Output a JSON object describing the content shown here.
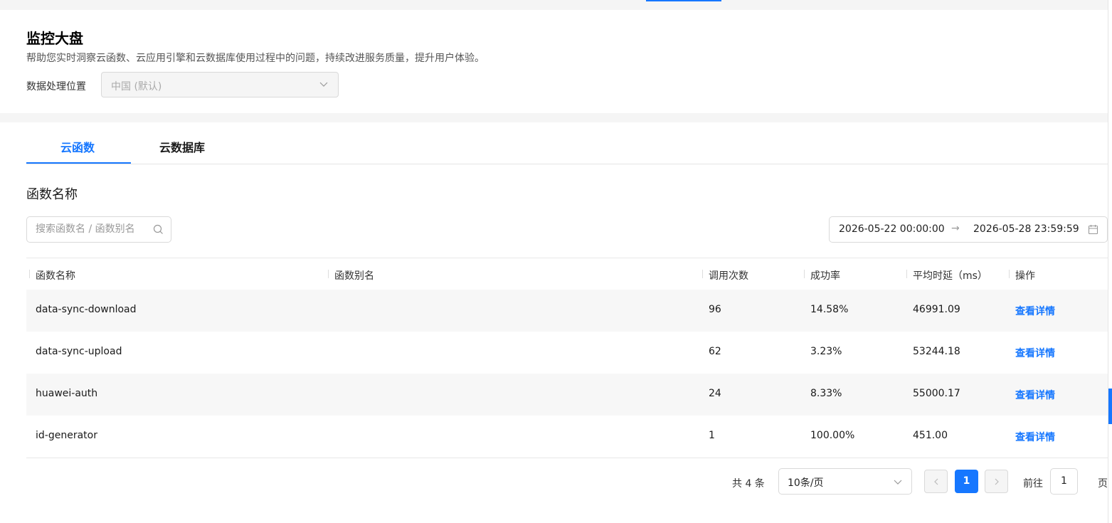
{
  "header": {
    "title": "监控大盘",
    "description": "帮助您实时洞察云函数、云应用引擎和云数据库使用过程中的问题，持续改进服务质量，提升用户体验。",
    "location_label": "数据处理位置",
    "location_value": "中国 (默认)"
  },
  "tabs": [
    {
      "label": "云函数",
      "active": true
    },
    {
      "label": "云数据库",
      "active": false
    }
  ],
  "section": {
    "title": "函数名称",
    "search_placeholder": "搜索函数名 / 函数别名"
  },
  "date_range": {
    "start": "2026-05-22 00:00:00",
    "separator": "→",
    "end": "2026-05-28 23:59:59"
  },
  "table": {
    "columns": [
      "函数名称",
      "函数别名",
      "调用次数",
      "成功率",
      "平均时延（ms）",
      "操作"
    ],
    "rows": [
      {
        "name": "data-sync-download",
        "alias": "",
        "calls": "96",
        "success_rate": "14.58%",
        "avg_latency": "46991.09",
        "action": "查看详情"
      },
      {
        "name": "data-sync-upload",
        "alias": "",
        "calls": "62",
        "success_rate": "3.23%",
        "avg_latency": "53244.18",
        "action": "查看详情"
      },
      {
        "name": "huawei-auth",
        "alias": "",
        "calls": "24",
        "success_rate": "8.33%",
        "avg_latency": "55000.17",
        "action": "查看详情"
      },
      {
        "name": "id-generator",
        "alias": "",
        "calls": "1",
        "success_rate": "100.00%",
        "avg_latency": "451.00",
        "action": "查看详情"
      }
    ]
  },
  "pagination": {
    "total_text": "共 4 条",
    "page_size": "10条/页",
    "current_page": "1",
    "goto_label": "前往",
    "goto_value": "1",
    "page_unit": "页"
  },
  "colors": {
    "accent": "#1677ff"
  },
  "icons": [
    "chevron-down-icon",
    "search-icon",
    "calendar-icon",
    "chevron-left-icon",
    "chevron-right-icon"
  ]
}
